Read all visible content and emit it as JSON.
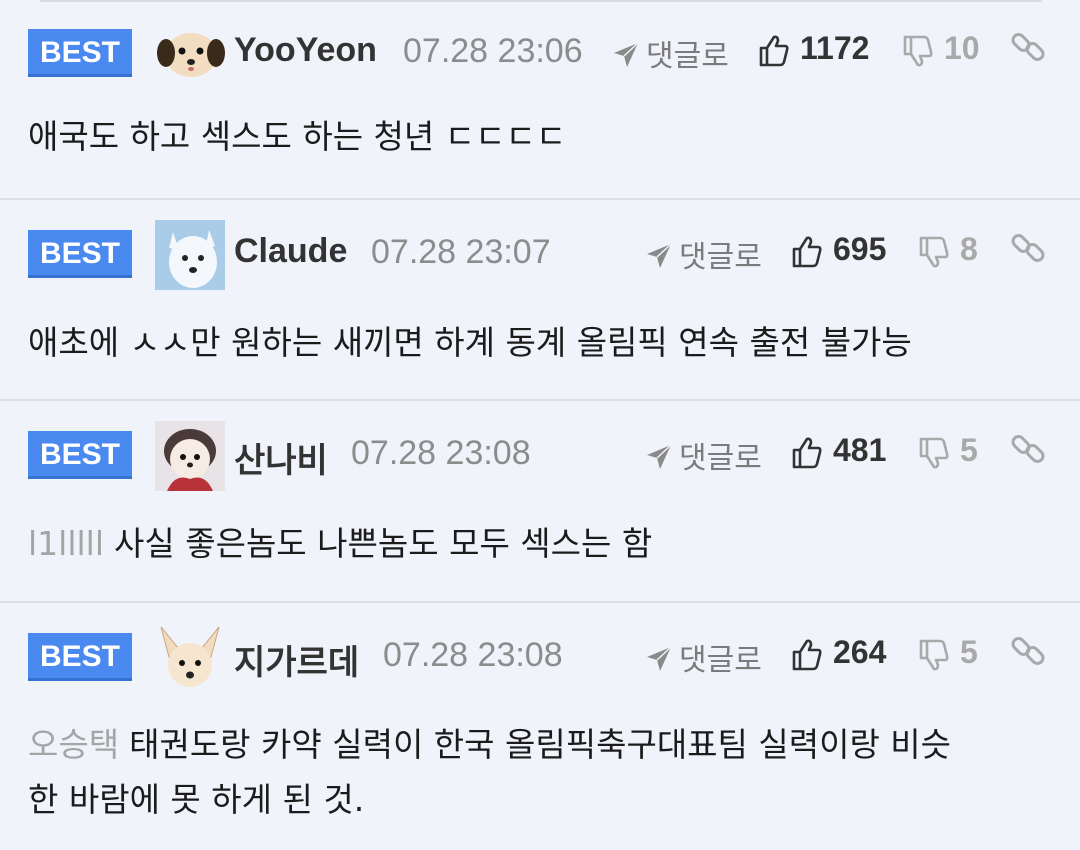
{
  "comments": [
    {
      "badge": "BEST",
      "author": "YooYeon",
      "time": "07.28 23:06",
      "reply_label": "댓글로",
      "likes": "1172",
      "dislikes": "10",
      "mention": "",
      "text": "애국도 하고 섹스도 하는 청년 ㄷㄷㄷㄷ",
      "text2": ""
    },
    {
      "badge": "BEST",
      "author": "Claude",
      "time": "07.28 23:07",
      "reply_label": "댓글로",
      "likes": "695",
      "dislikes": "8",
      "mention": "",
      "text": "애초에 ㅅㅅ만 원하는 새끼면 하계 동계 올림픽 연속 출전 불가능",
      "text2": ""
    },
    {
      "badge": "BEST",
      "author": "산나비",
      "time": "07.28 23:08",
      "reply_label": "댓글로",
      "likes": "481",
      "dislikes": "5",
      "mention": "l1lllll",
      "text": "사실 좋은놈도 나쁜놈도 모두 섹스는 함",
      "text2": ""
    },
    {
      "badge": "BEST",
      "author": "지가르데",
      "time": "07.28 23:08",
      "reply_label": "댓글로",
      "likes": "264",
      "dislikes": "5",
      "mention": "오승택",
      "text": "태권도랑 카약 실력이 한국 올림픽축구대표팀 실력이랑 비슷",
      "text2": "한 바람에 못 하게 된 것."
    }
  ],
  "colors": {
    "background": "#f1f3fa",
    "best_badge": "#4a8af0",
    "divider": "#dcdee5"
  },
  "icons": {
    "reply": "paper-plane-icon",
    "like": "thumbs-up-icon",
    "dislike": "thumbs-down-icon",
    "link": "link-icon"
  }
}
